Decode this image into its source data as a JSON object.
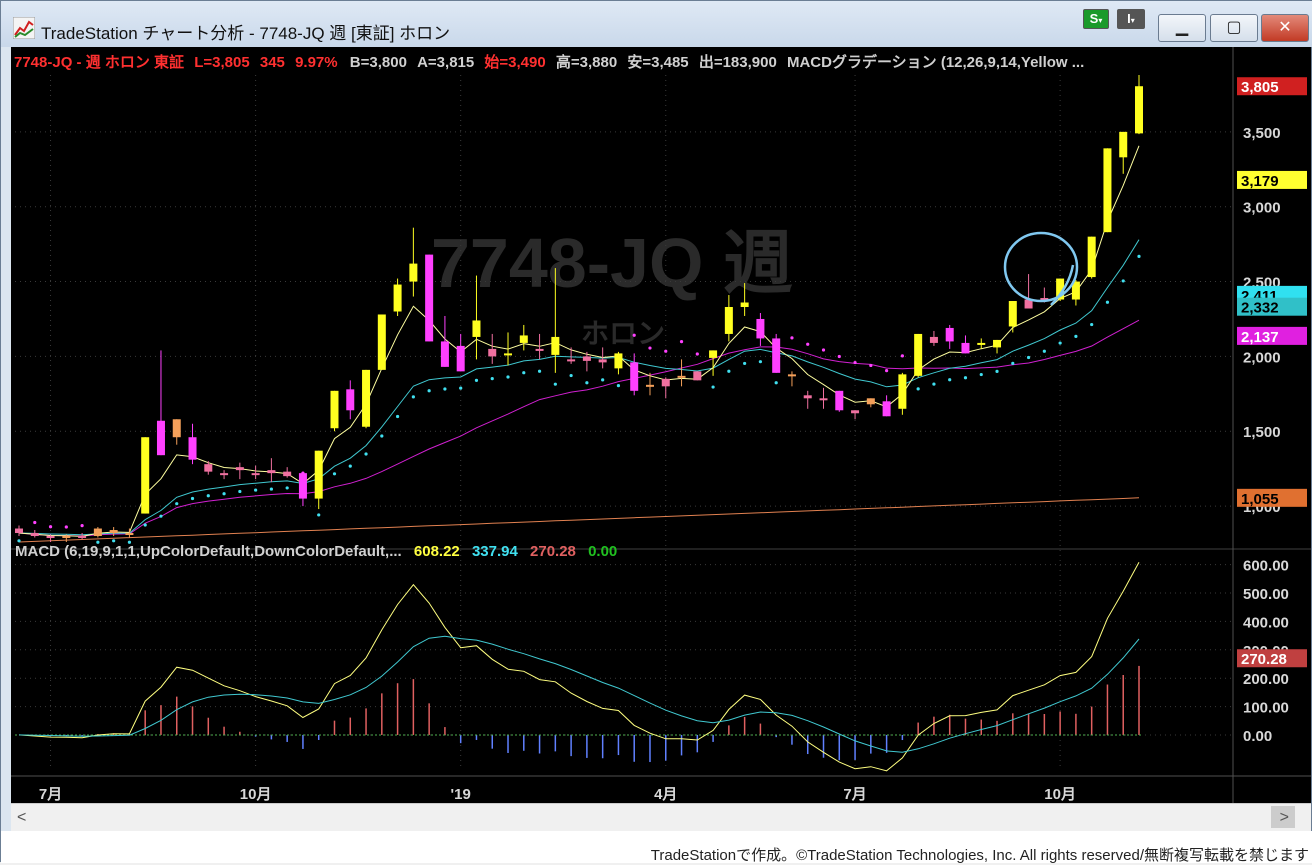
{
  "window": {
    "title": "TradeStation チャート分析 - 7748-JQ 週 [東証] ホロン",
    "status_btn_s": "S",
    "status_btn_i": "I",
    "min_icon": "minimize-icon",
    "max_icon": "maximize-icon",
    "close_icon": "close-icon"
  },
  "header": {
    "symbol": "7748-JQ - 週  ホロン  東証",
    "last": "L=3,805",
    "change": "345",
    "change_pct": "9.97%",
    "bid": "B=3,800",
    "ask": "A=3,815",
    "open": "始=3,490",
    "high": "高=3,880",
    "low": "安=3,485",
    "volume": "出=183,900",
    "indicator": "MACDグラデーション (12,26,9,14,Yellow ..."
  },
  "watermark": {
    "symbol": "7748-JQ 週",
    "name": "ホロン"
  },
  "macd_header": {
    "label": "MACD (6,19,9,1,1,UpColorDefault,DownColorDefault,...",
    "v1": "608.22",
    "v2": "337.94",
    "v3": "270.28",
    "v4": "0.00"
  },
  "colors": {
    "up": "#ffff20",
    "down": "#ff40ff",
    "mid_up": "#f4a05a",
    "mid_down": "#f070a0",
    "ma_fast": "#ffffa0",
    "ma_mid": "#40c8d0",
    "ma_slow": "#d020d0",
    "ma_long": "#e08050",
    "sar": "#40e0f0",
    "macd_line": "#ffff80",
    "signal_line": "#40c8d0",
    "hist_up": "#e06060",
    "hist_down": "#6080ff"
  },
  "chart_data": {
    "type": "candlestick",
    "price_axis": {
      "ticks": [
        3500,
        3000,
        2500,
        2000,
        1500,
        1000
      ],
      "tick_labels": [
        "3,500",
        "3,000",
        "2,500",
        "2,000",
        "1,500",
        "1,000"
      ],
      "range": [
        780,
        3880
      ]
    },
    "price_markers": [
      {
        "label": "3,805",
        "value": 3805,
        "kind": "last"
      },
      {
        "label": "3,179",
        "value": 3179,
        "kind": "ma_fast"
      },
      {
        "label": "2,411",
        "value": 2411,
        "kind": "sar"
      },
      {
        "label": "2,332",
        "value": 2332,
        "kind": "ma_mid"
      },
      {
        "label": "2,137",
        "value": 2137,
        "kind": "ma_slow"
      },
      {
        "label": "1,055",
        "value": 1055,
        "kind": "ma_long"
      }
    ],
    "x_labels": [
      {
        "label": "7月",
        "index": 2
      },
      {
        "label": "10月",
        "index": 15
      },
      {
        "label": "'19",
        "index": 28
      },
      {
        "label": "4月",
        "index": 41
      },
      {
        "label": "7月",
        "index": 53
      },
      {
        "label": "10月",
        "index": 66
      }
    ],
    "candles": [
      [
        850,
        870,
        800,
        820
      ],
      [
        820,
        840,
        790,
        800
      ],
      [
        800,
        810,
        760,
        790
      ],
      [
        790,
        810,
        760,
        800
      ],
      [
        800,
        820,
        780,
        790
      ],
      [
        800,
        860,
        790,
        850
      ],
      [
        820,
        860,
        800,
        840
      ],
      [
        810,
        850,
        790,
        820
      ],
      [
        950,
        1460,
        950,
        1460
      ],
      [
        1570,
        2040,
        1360,
        1340
      ],
      [
        1460,
        1440,
        1410,
        1580
      ],
      [
        1460,
        1550,
        1280,
        1310
      ],
      [
        1280,
        1300,
        1210,
        1230
      ],
      [
        1220,
        1240,
        1180,
        1210
      ],
      [
        1260,
        1290,
        1180,
        1240
      ],
      [
        1220,
        1270,
        1180,
        1210
      ],
      [
        1240,
        1320,
        1160,
        1220
      ],
      [
        1230,
        1260,
        1190,
        1200
      ],
      [
        1220,
        1100,
        1000,
        1050
      ],
      [
        1050,
        1360,
        980,
        1370
      ],
      [
        1520,
        1720,
        1500,
        1770
      ],
      [
        1780,
        1840,
        1580,
        1640
      ],
      [
        1530,
        1860,
        1520,
        1910
      ],
      [
        1910,
        2180,
        1920,
        2280
      ],
      [
        2300,
        2520,
        2270,
        2480
      ],
      [
        2500,
        2860,
        2400,
        2620
      ],
      [
        2680,
        2150,
        2100,
        2100
      ],
      [
        2100,
        2270,
        1930,
        1930
      ],
      [
        2070,
        2150,
        1900,
        1900
      ],
      [
        2130,
        2540,
        1980,
        2240
      ],
      [
        2050,
        2150,
        1950,
        2000
      ],
      [
        2010,
        2160,
        1940,
        2020
      ],
      [
        2090,
        2210,
        2040,
        2140
      ],
      [
        2050,
        2150,
        1980,
        2040
      ],
      [
        2010,
        2590,
        1890,
        2130
      ],
      [
        1980,
        2060,
        1950,
        1970
      ],
      [
        2000,
        2030,
        1900,
        1970
      ],
      [
        1980,
        2060,
        1920,
        1960
      ],
      [
        1920,
        2030,
        1880,
        2020
      ],
      [
        1960,
        2020,
        1740,
        1770
      ],
      [
        1800,
        1890,
        1740,
        1810
      ],
      [
        1850,
        1860,
        1720,
        1800
      ],
      [
        1870,
        1980,
        1800,
        1870
      ],
      [
        1900,
        1860,
        1840,
        1840
      ],
      [
        1990,
        2010,
        1870,
        2040
      ],
      [
        2150,
        2410,
        2100,
        2330
      ],
      [
        2330,
        2490,
        2270,
        2360
      ],
      [
        2250,
        2290,
        2070,
        2120
      ],
      [
        2120,
        2150,
        1900,
        1890
      ],
      [
        1880,
        1900,
        1800,
        1880
      ],
      [
        1740,
        1770,
        1650,
        1720
      ],
      [
        1720,
        1790,
        1650,
        1710
      ],
      [
        1770,
        1730,
        1630,
        1640
      ],
      [
        1640,
        1640,
        1580,
        1620
      ],
      [
        1680,
        1710,
        1660,
        1720
      ],
      [
        1700,
        1740,
        1620,
        1600
      ],
      [
        1650,
        1890,
        1610,
        1880
      ],
      [
        1870,
        2130,
        1860,
        2150
      ],
      [
        2130,
        2170,
        2070,
        2090
      ],
      [
        2190,
        2210,
        2050,
        2100
      ],
      [
        2090,
        2140,
        2020,
        2020
      ],
      [
        2080,
        2120,
        2050,
        2090
      ],
      [
        2060,
        2060,
        2020,
        2110
      ],
      [
        2200,
        2300,
        2160,
        2370
      ],
      [
        2380,
        2550,
        2350,
        2320
      ],
      [
        2390,
        2460,
        2360,
        2380
      ],
      [
        2380,
        2490,
        2370,
        2520
      ],
      [
        2380,
        2510,
        2340,
        2500
      ],
      [
        2530,
        2720,
        2520,
        2800
      ],
      [
        2830,
        3360,
        2830,
        3390
      ],
      [
        3330,
        3500,
        3220,
        3500
      ],
      [
        3490,
        3880,
        3485,
        3805
      ]
    ],
    "macd_axis": {
      "ticks": [
        600,
        500,
        400,
        300,
        200,
        100,
        0
      ],
      "tick_labels": [
        "600.00",
        "500.00",
        "400.00",
        "300.00",
        "200.00",
        "100.00",
        "0.00"
      ],
      "range": [
        -120,
        620
      ],
      "marker": {
        "label": "270.28",
        "value": 270.28
      }
    }
  },
  "scrollbar": {
    "left_icon": "chevron-left-icon",
    "right_icon": "chevron-right-icon",
    "left": "<",
    "right": ">"
  },
  "footer": "TradeStationで作成。©TradeStation Technologies, Inc. All rights reserved/無断複写転載を禁じます"
}
